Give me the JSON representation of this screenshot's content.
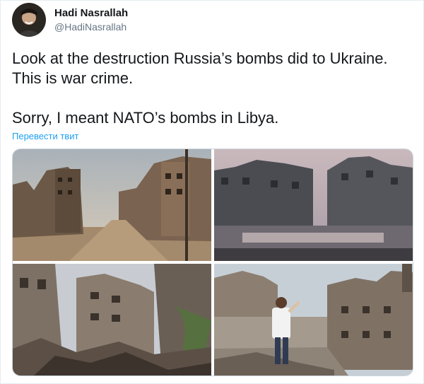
{
  "author": {
    "name": "Hadi Nasrallah",
    "handle": "@HadiNasrallah"
  },
  "tweet": {
    "text": "Look at the destruction Russia’s bombs did to Ukraine.\nThis is war crime.\n\nSorry, I meant NATO’s bombs in Libya.",
    "translate_label": "Перевести твит"
  },
  "colors": {
    "link": "#1da1f2",
    "handle": "#657786",
    "border": "#e6ecf0"
  },
  "icons": {
    "avatar": "profile-photo"
  },
  "media": {
    "count": 4
  }
}
